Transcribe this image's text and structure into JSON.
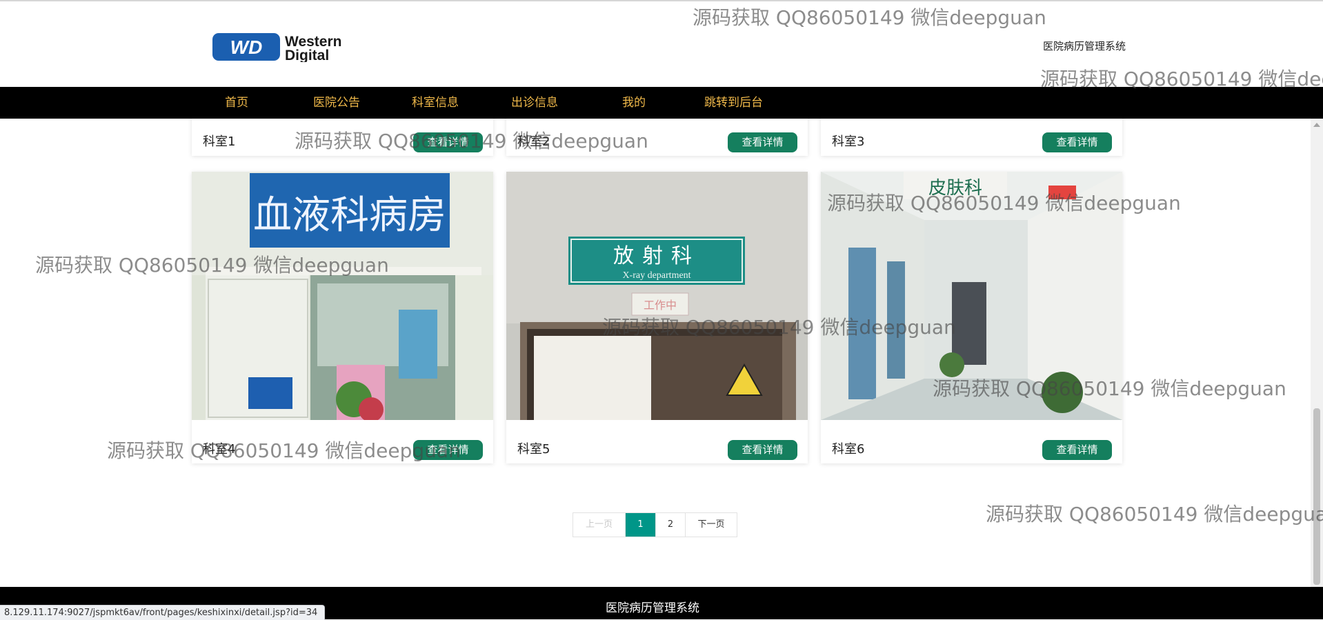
{
  "header": {
    "logo_line1": "Western",
    "logo_line2": "Digital",
    "logo_mark": "WD",
    "site_title": "医院病历管理系统"
  },
  "nav": {
    "items": [
      "首页",
      "医院公告",
      "科室信息",
      "出诊信息",
      "我的",
      "跳转到后台"
    ]
  },
  "departments": [
    {
      "name": "科室1",
      "button": "查看详情"
    },
    {
      "name": "科室2",
      "button": "查看详情"
    },
    {
      "name": "科室3",
      "button": "查看详情"
    },
    {
      "name": "科室4",
      "button": "查看详情",
      "sign": "血液科病房"
    },
    {
      "name": "科室5",
      "button": "查看详情",
      "sign": "放射科",
      "sign_sub": "X-ray department",
      "lamp": "工作中"
    },
    {
      "name": "科室6",
      "button": "查看详情",
      "sign": "皮肤科"
    }
  ],
  "pagination": {
    "prev": "上一页",
    "current": "1",
    "page2": "2",
    "next": "下一页"
  },
  "footer": {
    "text": "医院病历管理系统"
  },
  "status_bar": {
    "url": "8.129.11.174:9027/jspmkt6av/front/pages/keshixinxi/detail.jsp?id=34"
  },
  "watermark": {
    "text": "源码获取 QQ86050149 微信deepguan"
  },
  "colors": {
    "nav_bg": "#000000",
    "nav_text": "#f0b94a",
    "button_bg": "#157f5e",
    "pager_active": "#009688"
  }
}
